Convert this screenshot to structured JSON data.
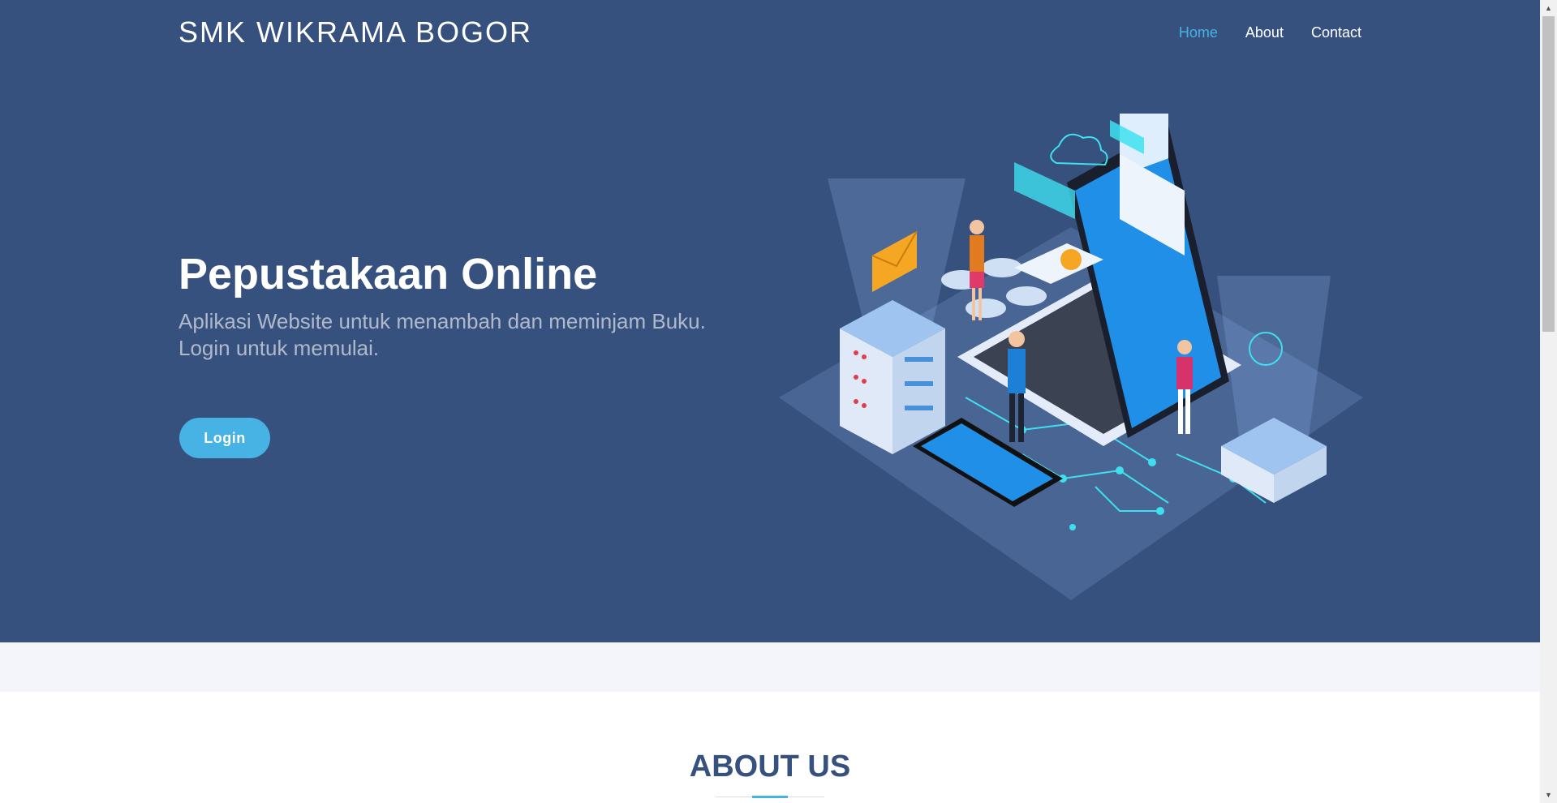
{
  "header": {
    "brand": "SMK WIKRAMA BOGOR",
    "nav": {
      "home": "Home",
      "about": "About",
      "contact": "Contact"
    }
  },
  "hero": {
    "title": "Pepustakaan Online",
    "subtitle": "Aplikasi Website untuk menambah dan meminjam Buku. Login untuk memulai.",
    "login_label": "Login"
  },
  "about": {
    "title": "ABOUT US"
  },
  "icons": {
    "illustration": "isometric-laptop-server-illustration",
    "scroll_up": "triangle-up-icon",
    "scroll_down": "triangle-down-icon"
  },
  "colors": {
    "hero_background": "#37517e",
    "accent": "#47b2e4",
    "strip_background": "#f3f5fa",
    "heading": "#37517e"
  }
}
